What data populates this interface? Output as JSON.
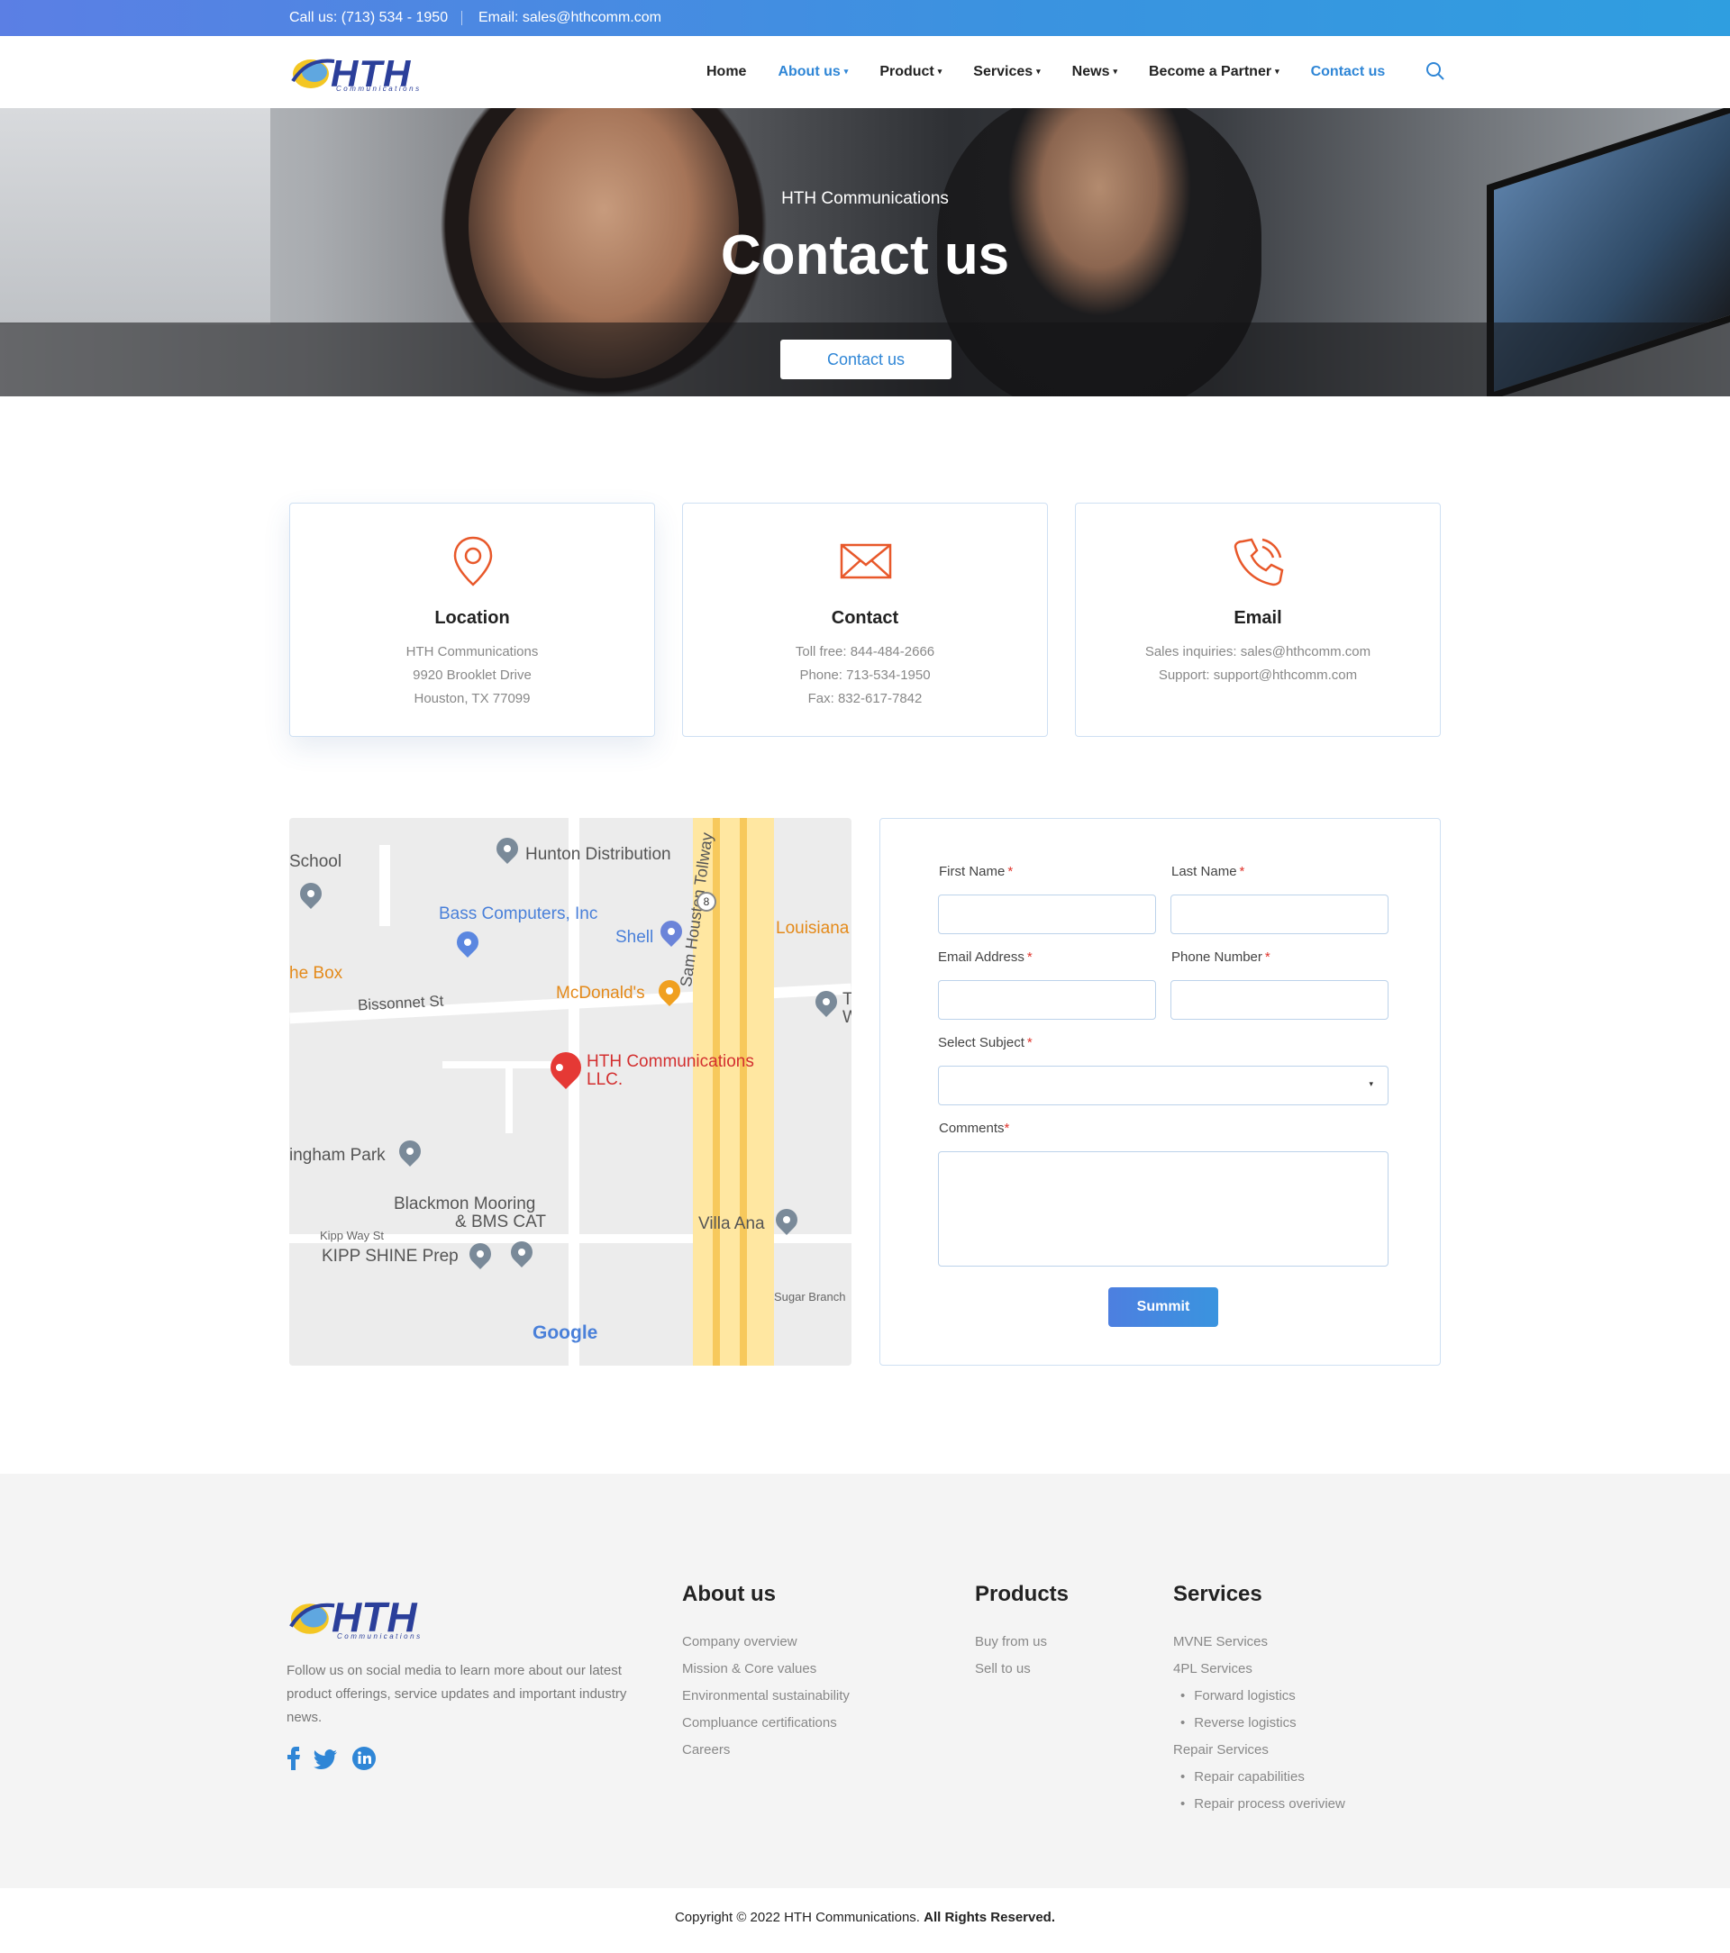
{
  "topbar": {
    "phone": "Call us: (713) 534 - 1950",
    "email": "Email: sales@hthcomm.com"
  },
  "header": {
    "logo_text": "HTH",
    "logo_sub": "Communications",
    "nav": [
      {
        "label": "Home",
        "has_dropdown": false,
        "active": false
      },
      {
        "label": "About us",
        "has_dropdown": true,
        "active": true
      },
      {
        "label": "Product",
        "has_dropdown": true,
        "active": false
      },
      {
        "label": "Services",
        "has_dropdown": true,
        "active": false
      },
      {
        "label": "News",
        "has_dropdown": true,
        "active": false
      },
      {
        "label": "Become a Partner",
        "has_dropdown": true,
        "active": false
      },
      {
        "label": "Contact us",
        "has_dropdown": false,
        "active": true
      }
    ],
    "search_icon": "search-icon"
  },
  "hero": {
    "subtitle": "HTH Communications",
    "title": "Contact us",
    "button": "Contact us"
  },
  "cards": {
    "location": {
      "title": "Location",
      "lines": [
        "HTH Communications",
        "9920 Brooklet Drive",
        "Houston, TX 77099"
      ],
      "icon": "map-pin-icon"
    },
    "contact": {
      "title": "Contact",
      "lines": [
        "Toll free: 844-484-2666",
        "Phone: 713-534-1950",
        "Fax: 832-617-7842"
      ],
      "icon": "envelope-icon"
    },
    "email": {
      "title": "Email",
      "lines": [
        "Sales inquiries: sales@hthcomm.com",
        "Support: support@hthcomm.com"
      ],
      "icon": "phone-icon"
    }
  },
  "map": {
    "labels": {
      "school": "School",
      "hunton": "Hunton Distribution",
      "bass": "Bass Computers, Inc",
      "shell": "Shell",
      "louisiana": "Louisiana",
      "hebox": "he Box",
      "bissonnet": "Bissonnet St",
      "mcdonalds": "McDonald's",
      "hth1": "HTH Communications",
      "hth2": "LLC.",
      "park": "ingham Park",
      "blackmon1": "Blackmon Mooring",
      "blackmon2": "& BMS CAT",
      "kippway": "Kipp Way St",
      "kipp": "KIPP SHINE Prep",
      "villa": "Villa Ana",
      "sugar": "Sugar Branch",
      "tollway": "Sam Houston Tollway",
      "route": "8",
      "tw": "T\nW",
      "google": "Google"
    }
  },
  "form": {
    "first_name": "First Name",
    "last_name": "Last Name",
    "email": "Email Address",
    "phone": "Phone Number",
    "subject": "Select Subject",
    "comments": "Comments",
    "required_mark": "*",
    "submit": "Summit"
  },
  "footer": {
    "logo_text": "HTH",
    "logo_sub": "Communications",
    "text": "Follow us on social media to learn more about our latest product offerings, service updates and important industry news.",
    "social": [
      "facebook-icon",
      "twitter-icon",
      "linkedin-icon"
    ],
    "about": {
      "title": "About us",
      "links": [
        "Company overview",
        "Mission & Core values",
        "Environmental sustainability",
        "Compluance certifications",
        "Careers"
      ]
    },
    "products": {
      "title": "Products",
      "links": [
        "Buy from us",
        "Sell to us"
      ]
    },
    "services": {
      "title": "Services",
      "links": [
        {
          "label": "MVNE Services",
          "sub": false
        },
        {
          "label": "4PL Services",
          "sub": false
        },
        {
          "label": "Forward logistics",
          "sub": true
        },
        {
          "label": "Reverse logistics",
          "sub": true
        },
        {
          "label": "Repair Services",
          "sub": false
        },
        {
          "label": "Repair capabilities",
          "sub": true
        },
        {
          "label": "Repair process overiview",
          "sub": true
        }
      ]
    },
    "copyright_prefix": "Copyright © 2022 HTH Communications.",
    "copyright_suffix": "All Rights Reserved."
  },
  "colors": {
    "accent": "#2f86d6",
    "icon_orange": "#e8582a",
    "logo_blue": "#2b3f9a",
    "required": "#e0342c"
  }
}
